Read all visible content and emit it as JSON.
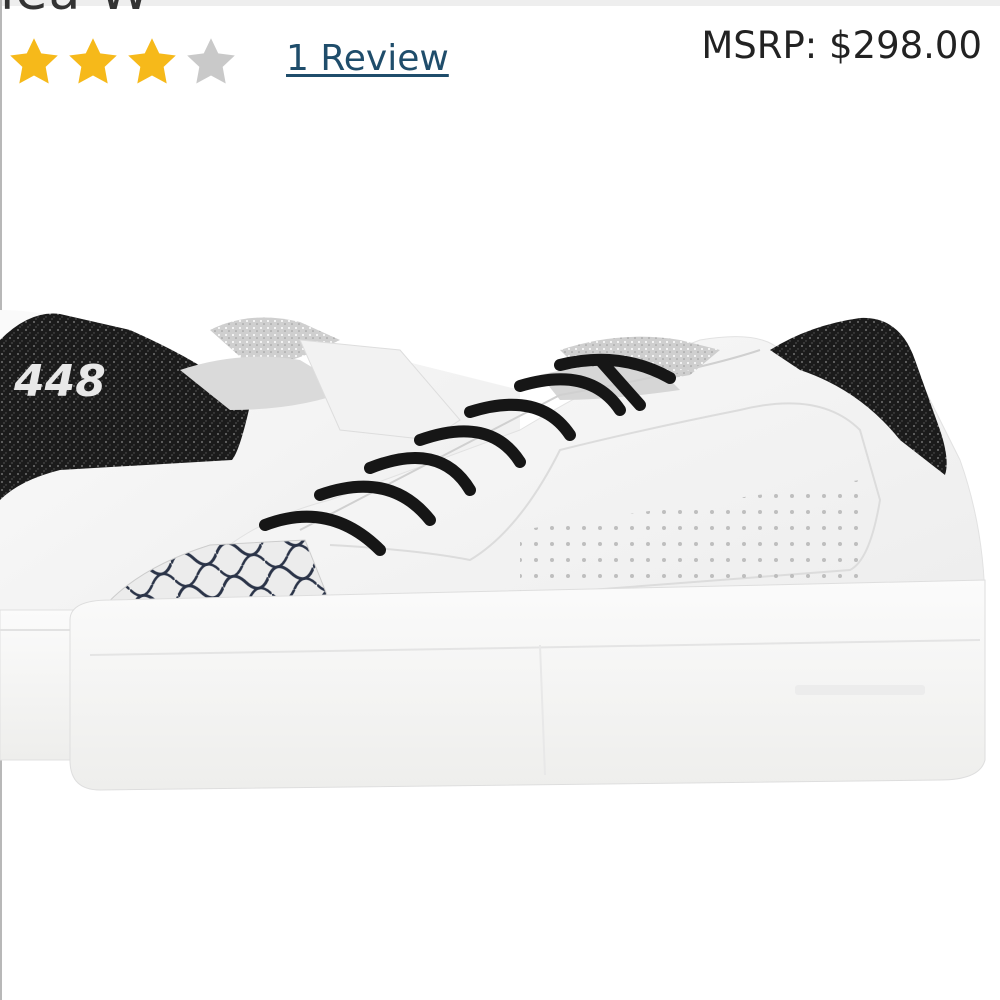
{
  "product": {
    "title_fragment": "lea W",
    "rating": {
      "value": 3,
      "max": 5,
      "filled_color": "#f6b91a",
      "empty_color": "#c9c9c9",
      "icon": "star-icon"
    },
    "review_link": "1 Review",
    "msrp": "MSRP: $298.00",
    "image": {
      "alt": "P448 white leather sneakers with black glitter heel and silver snakeskin toe",
      "heel_logo_text": "448"
    }
  },
  "colors": {
    "link": "#1f4d6b",
    "text": "#222222"
  }
}
